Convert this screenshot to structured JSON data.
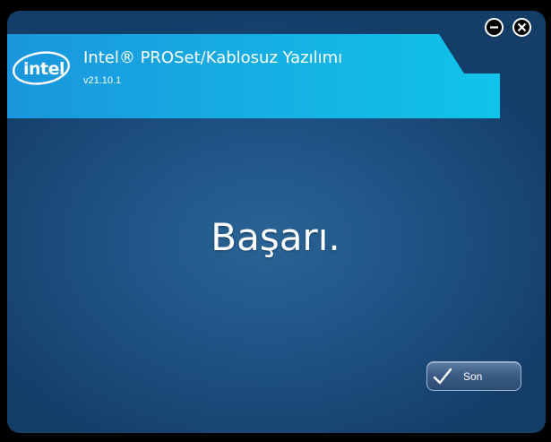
{
  "window": {
    "title": "Intel® PROSet/Kablosuz Yazılımı",
    "version": "v21.10.1",
    "logo_text": "intel",
    "minimize_icon": "minus-circle-icon",
    "close_icon": "x-circle-icon"
  },
  "main": {
    "message": "Başarı."
  },
  "footer": {
    "finish_label": "Son",
    "finish_icon": "checkmark-icon"
  },
  "colors": {
    "header_band": "#1aa8e2",
    "background": "#1f5486",
    "button": "#3e5d86"
  }
}
